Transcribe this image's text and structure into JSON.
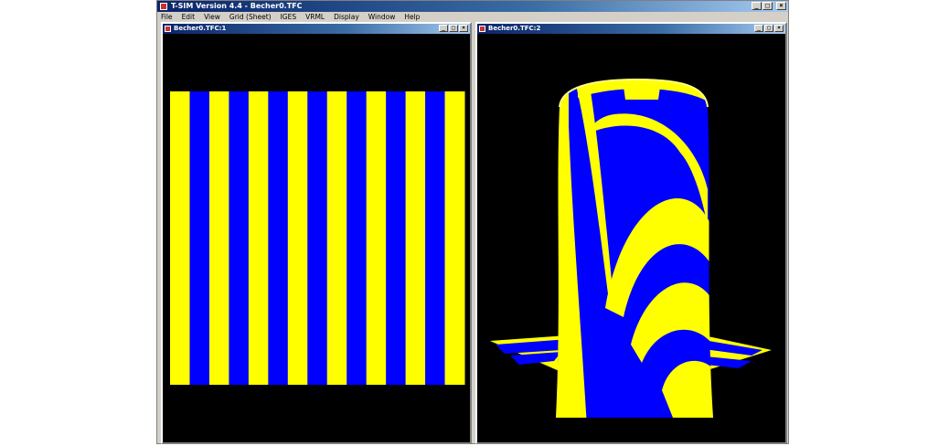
{
  "app": {
    "title": "T-SIM Version 4.4 - Becher0.TFC",
    "menu": [
      "File",
      "Edit",
      "View",
      "Grid (Sheet)",
      "IGES",
      "VRML",
      "Display",
      "Window",
      "Help"
    ],
    "window_buttons": {
      "minimize": "_",
      "maximize": "□",
      "close": "×"
    }
  },
  "windows": [
    {
      "title": "Becher0.TFC:1",
      "view": "flat stripe pattern"
    },
    {
      "title": "Becher0.TFC:2",
      "view": "3d formed cup"
    }
  ],
  "colors": {
    "stripe_yellow": "#ffff00",
    "stripe_blue": "#0000ff",
    "viewport_bg": "#000000"
  },
  "flat_pattern": {
    "yellow_stripes": 8,
    "blue_stripes": 7
  }
}
